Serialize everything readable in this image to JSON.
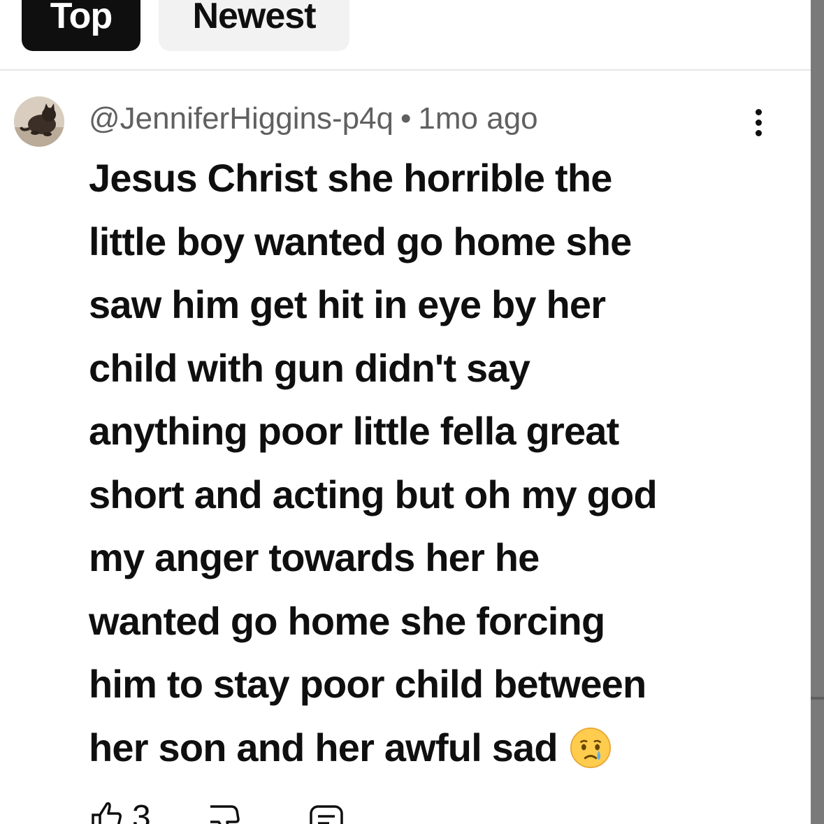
{
  "sort_tabs": {
    "top_label": "Top",
    "newest_label": "Newest"
  },
  "comment": {
    "author": "@JenniferHiggins-p4q",
    "separator": "•",
    "time": "1mo ago",
    "lines": [
      "Jesus Christ she horrible the",
      "little boy wanted go home she",
      "saw him get hit in eye by her",
      "child with gun didn't say",
      "anything poor little fella great",
      "short and acting but oh my god",
      "my anger towards her he",
      "wanted go home she forcing",
      "him to stay poor child between",
      "her son and her awful sad"
    ],
    "emoji": "crying-face-emoji",
    "like_count": "3"
  },
  "icons": {
    "more": "more-vertical-icon",
    "like": "thumbs-up-icon",
    "dislike": "thumbs-down-icon",
    "reply": "reply-icon"
  },
  "colors": {
    "active_chip": "#0f0f0f",
    "inactive_chip": "#f2f2f2",
    "meta_text": "#606060",
    "body_text": "#0f0f0f"
  }
}
